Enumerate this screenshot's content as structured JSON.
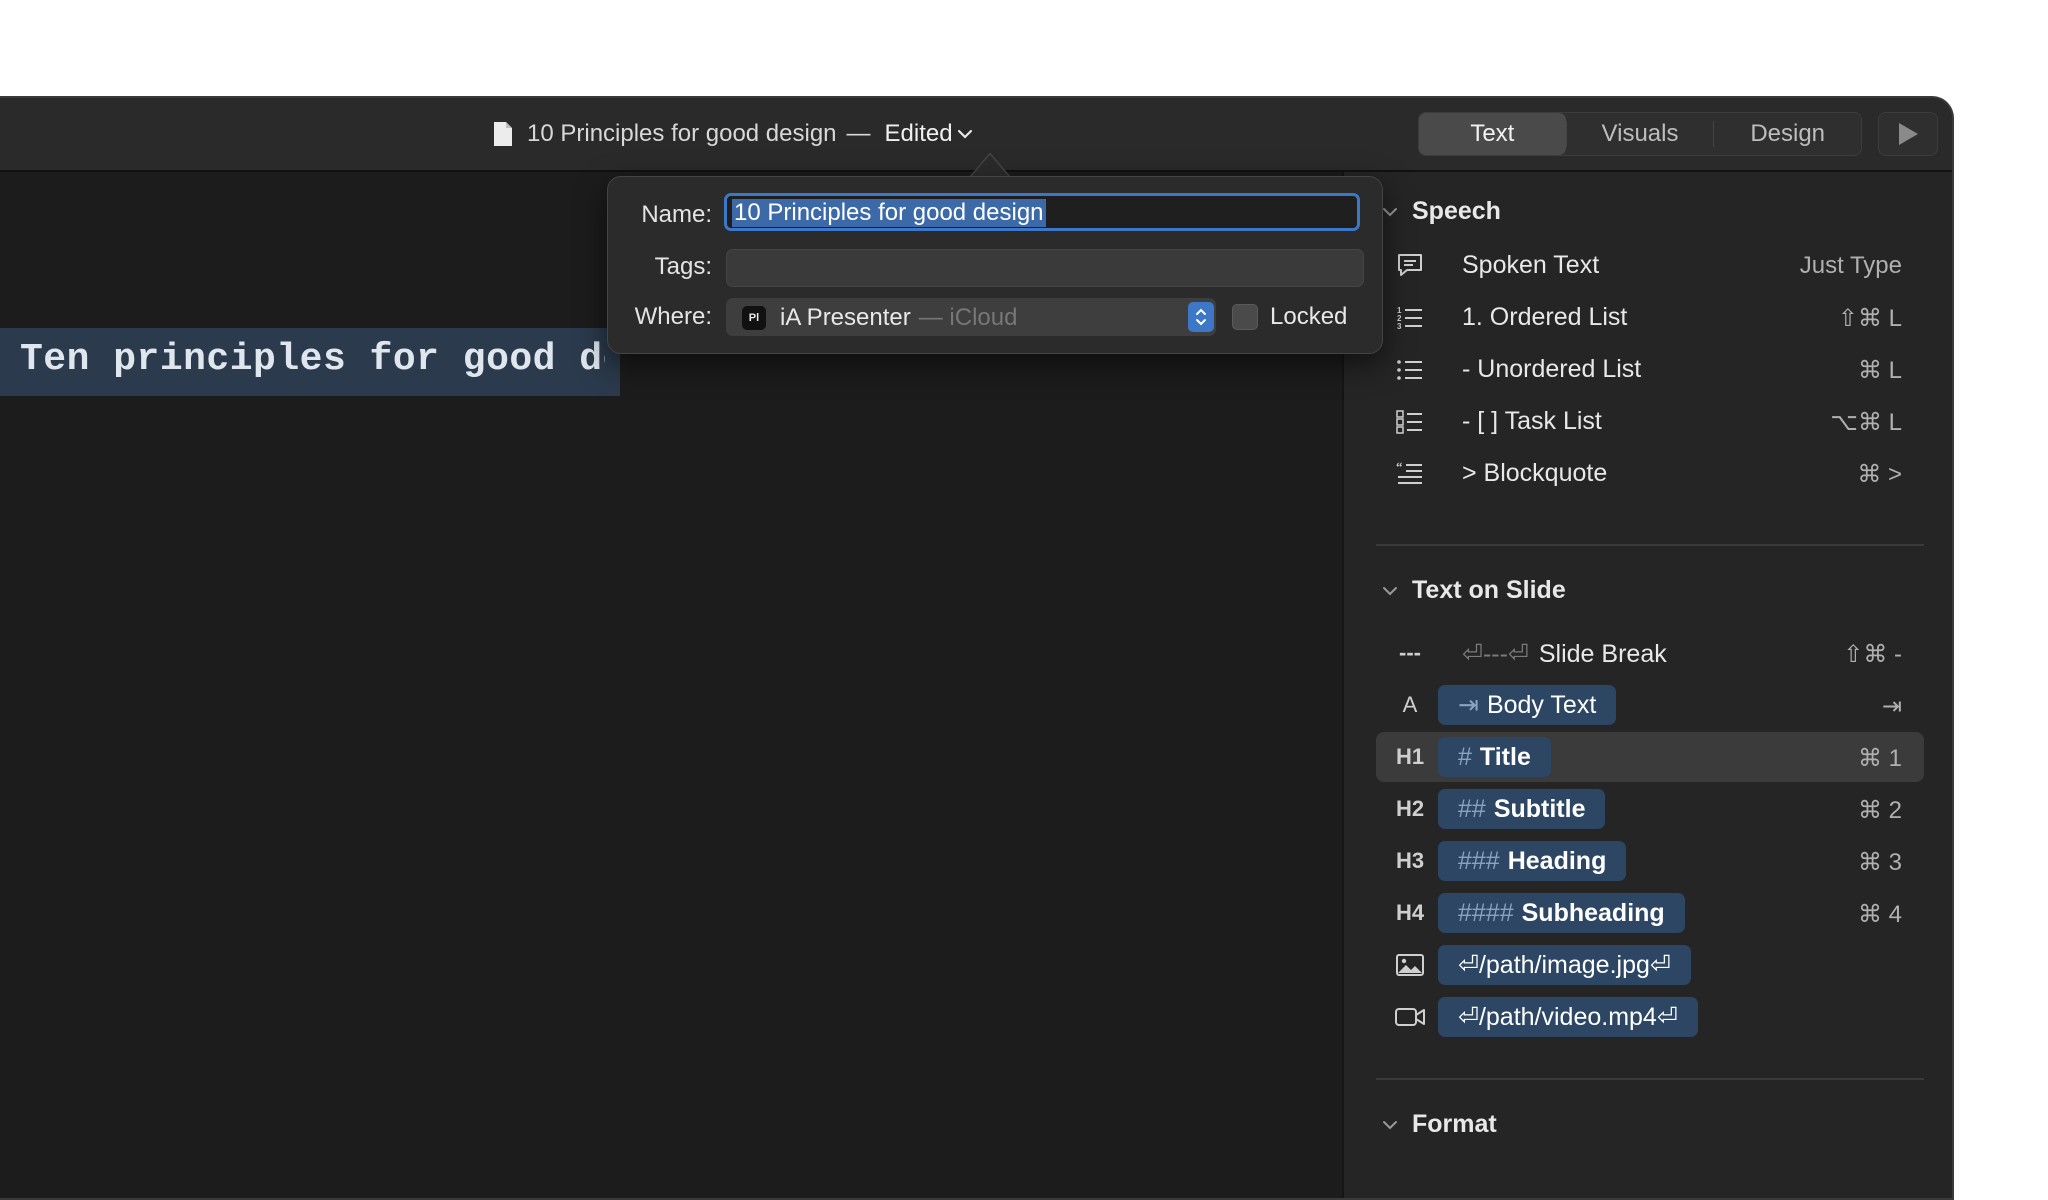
{
  "titlebar": {
    "document_name": "10 Principles for good design",
    "separator": "—",
    "status": "Edited",
    "tabs": [
      {
        "label": "Text",
        "active": true
      },
      {
        "label": "Visuals",
        "active": false
      },
      {
        "label": "Design",
        "active": false
      }
    ],
    "play_icon": "play-icon"
  },
  "editor": {
    "selected_line": "Ten principles for good design"
  },
  "popover": {
    "name_label": "Name:",
    "name_value": "10 Principles for good design",
    "tags_label": "Tags:",
    "tags_value": "",
    "where_label": "Where:",
    "where_app": "iA Presenter",
    "where_app_icon_text": "Pl",
    "where_location": "— iCloud",
    "locked_label": "Locked",
    "locked_checked": false
  },
  "sidebar": {
    "speech": {
      "title": "Speech",
      "items": [
        {
          "label": "Spoken Text",
          "shortcut": "Just Type",
          "icon": "speech-bubble-icon"
        },
        {
          "label": "1. Ordered List",
          "shortcut": "⇧⌘ L",
          "icon": "ordered-list-icon"
        },
        {
          "label": "- Unordered List",
          "shortcut": "⌘ L",
          "icon": "unordered-list-icon"
        },
        {
          "label": "- [ ] Task List",
          "shortcut": "⌥⌘ L",
          "icon": "task-list-icon"
        },
        {
          "label": "> Blockquote",
          "shortcut": "⌘ >",
          "icon": "blockquote-icon"
        }
      ]
    },
    "text_on_slide": {
      "title": "Text on Slide",
      "slide_break": {
        "icon_text": "---",
        "markup": "⏎---⏎",
        "label": "Slide Break",
        "shortcut": "⇧⌘ -"
      },
      "body_text": {
        "icon_text": "A",
        "markup": "⇥",
        "label": "Body Text",
        "shortcut": "⇥"
      },
      "headings": [
        {
          "tag": "H1",
          "markup": "#",
          "label": "Title",
          "shortcut": "⌘ 1"
        },
        {
          "tag": "H2",
          "markup": "##",
          "label": "Subtitle",
          "shortcut": "⌘ 2"
        },
        {
          "tag": "H3",
          "markup": "###",
          "label": "Heading",
          "shortcut": "⌘ 3"
        },
        {
          "tag": "H4",
          "markup": "####",
          "label": "Subheading",
          "shortcut": "⌘ 4"
        }
      ],
      "media": [
        {
          "icon": "image-icon",
          "label": "⏎/path/image.jpg⏎"
        },
        {
          "icon": "video-icon",
          "label": "⏎/path/video.mp4⏎"
        }
      ]
    },
    "format": {
      "title": "Format"
    }
  },
  "colors": {
    "accent": "#3d77c7",
    "pill": "#2c4664",
    "editor_highlight": "#2b3a4c"
  }
}
